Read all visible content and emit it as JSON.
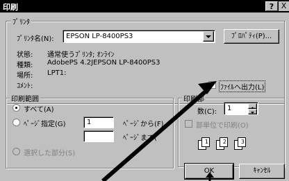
{
  "window": {
    "title": "印刷",
    "help_glyph": "?",
    "close_glyph": "X"
  },
  "printer": {
    "group_label": "ﾌﾟﾘﾝﾀ",
    "name_label": "ﾌﾟﾘﾝﾀ名(N):",
    "name_value": "EPSON LP-8400PS3",
    "properties_button": "ﾌﾟﾛﾊﾟﾃｨ(P)...",
    "status_label": "状態:",
    "status_value": "通常使うﾌﾟﾘﾝﾀ; ｵﾝﾗｲﾝ",
    "type_label": "種類:",
    "type_value": "AdobePS 4.2JEPSON LP-8400PS3",
    "location_label": "場所:",
    "location_value": "LPT1:",
    "comment_label": "ｺﾒﾝﾄ:",
    "print_to_file_label": "ﾌｧｲﾙへ出力(L)",
    "print_to_file_checked": true
  },
  "range": {
    "group_label": "印刷範囲",
    "all_label": "すべて(A)",
    "pages_label": "ﾍﾟｰｼﾞ指定(G)",
    "from_value": "1",
    "from_label": "ﾍﾟｰｼﾞから(F)",
    "to_value": "",
    "to_label": "ﾍﾟｰｼﾞまで(",
    "selection_label": "選択した部分(S)"
  },
  "copies": {
    "group_label": "印刷部",
    "count_label": "数(C):",
    "count_value": "1",
    "collate_label": "部単位で印刷(O)",
    "pages": [
      "1",
      "2",
      "3"
    ]
  },
  "buttons": {
    "ok": "OK",
    "cancel": "ｷｬﾝｾﾙ"
  }
}
